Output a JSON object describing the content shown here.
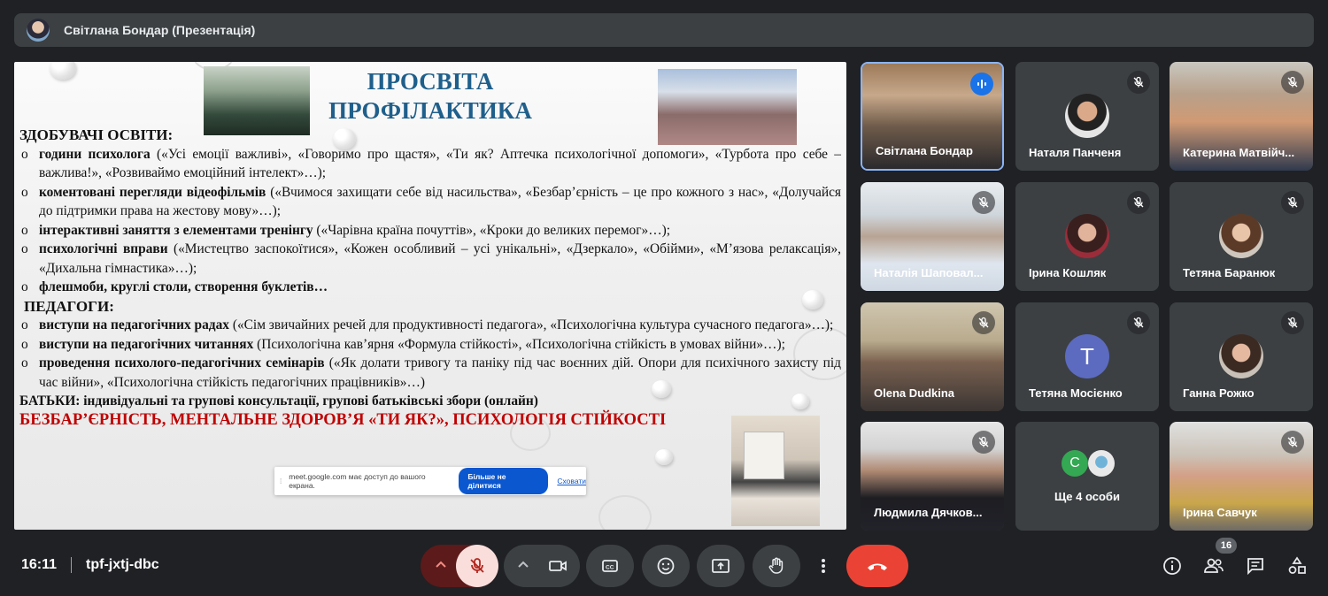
{
  "header": {
    "title": "Світлана Бондар (Презентація)"
  },
  "slide": {
    "title_line1": "ПРОСВІТА",
    "title_line2": "ПРОФІЛАКТИКА",
    "students_heading": "ЗДОБУВАЧІ ОСВІТИ:",
    "items_students": [
      {
        "bold": "години психолога",
        "rest": " («Усі емоції важливі», «Говоримо про щастя», «Ти як? Аптечка психологічної допомоги», «Турбота про себе – важлива!», «Розвиваймо емоційний інтелект»…);"
      },
      {
        "bold": "коментовані перегляди відеофільмів",
        "rest": " («Вчимося захищати себе від насильства», «Безбар’єрність – це про кожного з нас», «Долучайся до підтримки права на жестову мову»…);"
      },
      {
        "bold": "інтерактивні заняття з елементами тренінгу",
        "rest": " («Чарівна країна почуттів», «Кроки до великих перемог»…);"
      },
      {
        "bold": "психологічні вправи",
        "rest": " («Мистецтво заспокоїтися», «Кожен особливий – усі унікальні», «Дзеркало», «Обійми», «М’язова релаксація», «Дихальна гімнастика»…);"
      },
      {
        "bold": "флешмоби, круглі столи, створення буклетів…",
        "rest": ""
      }
    ],
    "teachers_heading": "ПЕДАГОГИ:",
    "items_teachers": [
      {
        "bold": "виступи на педагогічних радах",
        "rest": " («Сім звичайних речей для продуктивності педагога», «Психологічна культура сучасного педагога»…);"
      },
      {
        "bold": "виступи на педагогічних читаннях",
        "rest": " (Психологічна кав’ярня «Формула стійкості», «Психологічна стійкість в умовах війни»…);"
      },
      {
        "bold": "проведення психолого-педагогічних семінарів",
        "rest": " («Як долати тривогу та паніку під час воєнних дій. Опори для психічного захисту під час війни», «Психологічна стійкість педагогічних працівників»…)"
      }
    ],
    "parents_line": "БАТЬКИ: індивідуальні та групові консультації, групові батьківські збори (онлайн)",
    "red_line": "БЕЗБАР’ЄРНІСТЬ, МЕНТАЛЬНЕ ЗДОРОВ’Я «ТИ ЯК?», ПСИХОЛОГІЯ СТІЙКОСТІ"
  },
  "share_bar": {
    "message": "meet.google.com має доступ до вашого екрана.",
    "stop_label": "Більше не ділитися",
    "hide_label": "Сховати"
  },
  "participants": [
    {
      "name": "Світлана Бондар",
      "state": "speaking"
    },
    {
      "name": "Наталя Панченя",
      "state": "muted"
    },
    {
      "name": "Катерина Матвійч...",
      "state": "muted"
    },
    {
      "name": "Наталія Шаповал...",
      "state": "muted"
    },
    {
      "name": "Ірина Кошляк",
      "state": "muted"
    },
    {
      "name": "Тетяна Баранюк",
      "state": "muted"
    },
    {
      "name": "Olena Dudkina",
      "state": "muted"
    },
    {
      "name": "Тетяна Мосієнко",
      "state": "muted",
      "initial": "T"
    },
    {
      "name": "Ганна Рожко",
      "state": "muted"
    },
    {
      "name": "Людмила Дячков...",
      "state": "muted"
    },
    {
      "name": "Ще 4 особи",
      "state": "group",
      "initial": "C"
    },
    {
      "name": "Ірина Савчук",
      "state": "muted"
    }
  ],
  "footer": {
    "time": "16:11",
    "meeting_code": "tpf-jxtj-dbc",
    "people_count": "16"
  },
  "colors": {
    "background": "#202124",
    "tile": "#3c4043",
    "end_call": "#ea4335",
    "accent_blue": "#1a73e8",
    "avatar_T": "#5c6bc0",
    "avatar_C": "#34a853"
  }
}
